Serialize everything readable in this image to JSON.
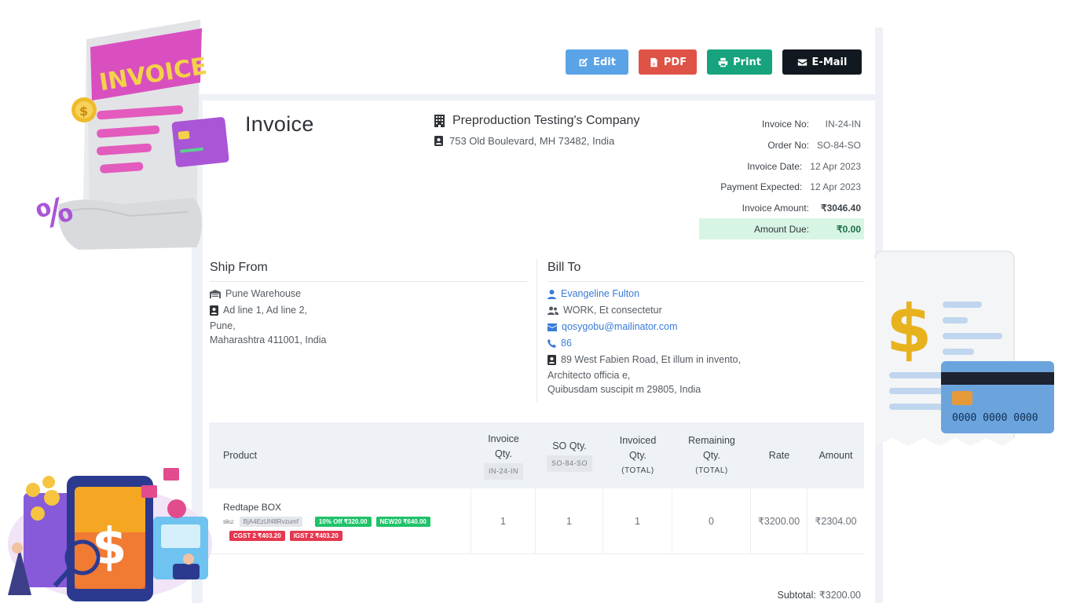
{
  "actions": {
    "edit": "Edit",
    "pdf": "PDF",
    "print": "Print",
    "email": "E-Mail"
  },
  "invoice_title": "Invoice",
  "company": {
    "name": "Preproduction Testing's Company",
    "address": "753 Old Boulevard, MH 73482, India"
  },
  "meta": [
    {
      "label": "Invoice No:",
      "value": "IN-24-IN"
    },
    {
      "label": "Order No:",
      "value": "SO-84-SO"
    },
    {
      "label": "Invoice Date:",
      "value": "12 Apr 2023"
    },
    {
      "label": "Payment Expected:",
      "value": "12 Apr 2023"
    },
    {
      "label": "Invoice Amount:",
      "value": "₹3046.40"
    },
    {
      "label": "Amount Due:",
      "value": "₹0.00"
    }
  ],
  "ship_from": {
    "heading": "Ship From",
    "warehouse": "Pune Warehouse",
    "line1": "Ad line 1, Ad line 2,",
    "line2": "Pune,",
    "line3": "Maharashtra 411001, India"
  },
  "bill_to": {
    "heading": "Bill To",
    "name": "Evangeline Fulton",
    "work": "WORK, Et consectetur",
    "email": "qosygobu@mailinator.com",
    "phone": "86",
    "line1": "89 West Fabien Road, Et illum in invento,",
    "line2": "Architecto officia e,",
    "line3": "Quibusdam suscipit m 29805, India"
  },
  "table": {
    "headers": {
      "product": "Product",
      "inv_qty_1": "Invoice",
      "inv_qty_2": "Qty.",
      "inv_qty_tag": "IN-24-IN",
      "so_qty": "SO Qty.",
      "so_qty_tag": "SO-84-SO",
      "invoiced_1": "Invoiced",
      "invoiced_2": "Qty.",
      "invoiced_sub": "(TOTAL)",
      "remaining_1": "Remaining",
      "remaining_2": "Qty.",
      "remaining_sub": "(TOTAL)",
      "rate": "Rate",
      "amount": "Amount"
    },
    "rows": [
      {
        "product": "Redtape BOX",
        "sku_label": "sku:",
        "sku": "BjA4EzUf48Rvzumf",
        "discounts": [
          "10% Off ₹320.00",
          "NEW20 ₹640.00"
        ],
        "taxes": [
          "CGST 2 ₹403.20",
          "IGST 2 ₹403.20"
        ],
        "inv_qty": "1",
        "so_qty": "1",
        "invoiced": "1",
        "remaining": "0",
        "rate": "₹3200.00",
        "amount": "₹2304.00"
      }
    ]
  },
  "subtotal": {
    "label": "Subtotal:",
    "value": "₹3200.00"
  },
  "illustration_text": {
    "invoice_banner": "INVOICE",
    "card_number": "0000 0000 0000"
  },
  "colors": {
    "edit": "#5aa3e6",
    "pdf": "#df5347",
    "print": "#16a37d",
    "email": "#11181f",
    "due_bg": "#d7f5e5",
    "link": "#3a7bd5"
  }
}
